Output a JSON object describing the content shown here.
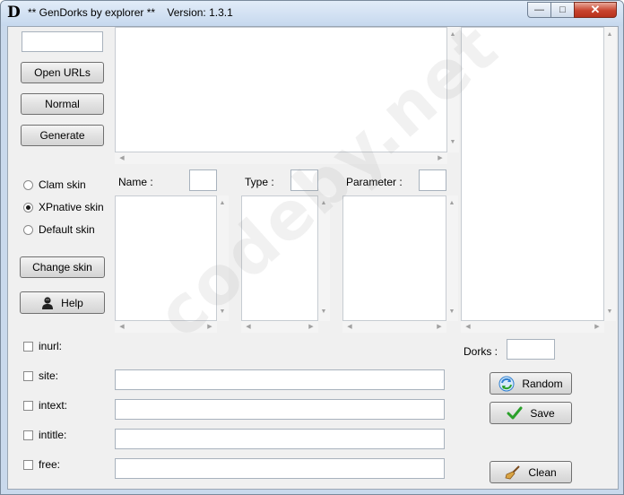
{
  "window": {
    "logo_letter": "D",
    "title": "** GenDorks by explorer **    Version: 1.3.1",
    "minimize_glyph": "—",
    "maximize_glyph": "□",
    "close_glyph": "✕"
  },
  "left_panel": {
    "open_urls_label": "Open URLs",
    "normal_label": "Normal",
    "generate_label": "Generate",
    "skins": [
      {
        "label": "Clam skin",
        "selected": false
      },
      {
        "label": "XPnative skin",
        "selected": true
      },
      {
        "label": "Default skin",
        "selected": false
      }
    ],
    "change_skin_label": "Change skin",
    "help_label": "Help"
  },
  "columns": {
    "name_label": "Name :",
    "type_label": "Type :",
    "parameter_label": "Parameter :"
  },
  "operators": [
    {
      "label": "inurl:",
      "checked": false,
      "has_field": false
    },
    {
      "label": "site:",
      "checked": false,
      "has_field": true,
      "value": ""
    },
    {
      "label": "intext:",
      "checked": false,
      "has_field": true,
      "value": ""
    },
    {
      "label": "intitle:",
      "checked": false,
      "has_field": true,
      "value": ""
    },
    {
      "label": "free:",
      "checked": false,
      "has_field": true,
      "value": ""
    }
  ],
  "right_panel": {
    "dorks_label": "Dorks :",
    "dorks_value": "",
    "random_label": "Random",
    "save_label": "Save",
    "clean_label": "Clean"
  },
  "watermark": "codeby.net",
  "icons": {
    "help": "person-silhouette-icon",
    "random": "refresh-arrows-icon",
    "save": "green-check-icon",
    "clean": "broom-icon"
  },
  "colors": {
    "title_bar": "#c6d8ee",
    "close_button": "#c8432e",
    "client_background": "#f0f0f0",
    "save_check": "#2aa02a",
    "random_icon": "#2f7fd0"
  }
}
